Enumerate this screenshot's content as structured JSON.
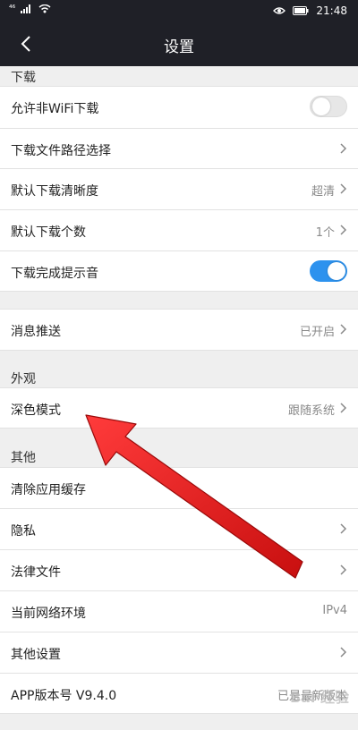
{
  "status": {
    "network": "⁴⁶",
    "time": "21:48",
    "eye_icon": "eye-icon",
    "signal_icon": "signal-icon",
    "wifi_icon": "wifi-icon",
    "battery_icon": "battery-icon"
  },
  "header": {
    "title": "设置"
  },
  "sections": {
    "download": "下载",
    "appearance": "外观",
    "other": "其他"
  },
  "rows": {
    "allow_non_wifi": {
      "label": "允许非WiFi下载"
    },
    "download_path": {
      "label": "下载文件路径选择"
    },
    "default_quality": {
      "label": "默认下载清晰度",
      "value": "超清"
    },
    "default_count": {
      "label": "默认下载个数",
      "value": "1个"
    },
    "download_sound": {
      "label": "下载完成提示音"
    },
    "push": {
      "label": "消息推送",
      "value": "已开启"
    },
    "dark_mode": {
      "label": "深色模式",
      "value": "跟随系统"
    },
    "clear_cache": {
      "label": "清除应用缓存"
    },
    "privacy": {
      "label": "隐私"
    },
    "legal": {
      "label": "法律文件"
    },
    "network_env": {
      "label": "当前网络环境",
      "value": "IPv4"
    },
    "other_settings": {
      "label": "其他设置"
    },
    "version": {
      "label": "APP版本号 V9.4.0",
      "value": "已是最新版本"
    }
  },
  "toggles": {
    "allow_non_wifi": false,
    "download_sound": true
  },
  "colors": {
    "header_bg": "#1f2027",
    "toggle_on": "#2d92ee",
    "arrow": "#e01e1e"
  },
  "watermark": {
    "text": "Bai 经验"
  }
}
